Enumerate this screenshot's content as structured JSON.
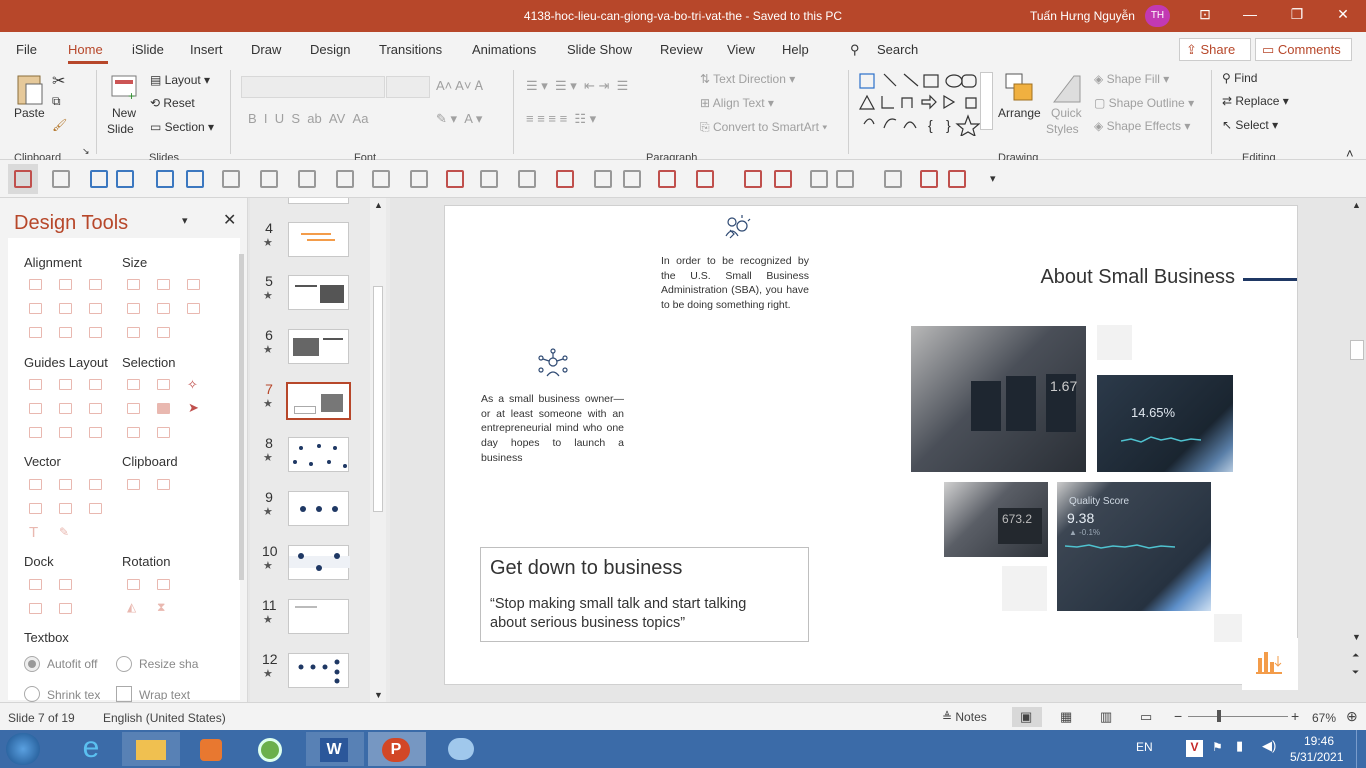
{
  "window": {
    "title": "4138-hoc-lieu-can-giong-va-bo-tri-vat-the  -  Saved to this PC",
    "user": "Tuấn Hưng Nguyễn",
    "initials": "TH"
  },
  "menu": [
    "File",
    "Home",
    "iSlide",
    "Insert",
    "Draw",
    "Design",
    "Transitions",
    "Animations",
    "Slide Show",
    "Review",
    "View",
    "Help"
  ],
  "search_label": "Search",
  "share_label": "Share",
  "comments_label": "Comments",
  "ribbon": {
    "clipboard": {
      "paste": "Paste",
      "group": "Clipboard"
    },
    "slides": {
      "new_slide_1": "New",
      "new_slide_2": "Slide",
      "layout": "Layout",
      "reset": "Reset",
      "section": "Section",
      "group": "Slides"
    },
    "font": {
      "group": "Font"
    },
    "paragraph": {
      "text_direction": "Text Direction",
      "align_text": "Align Text",
      "convert_smartart": "Convert to SmartArt",
      "group": "Paragraph"
    },
    "drawing": {
      "arrange": "Arrange",
      "quick_1": "Quick",
      "quick_2": "Styles",
      "shape_fill": "Shape Fill",
      "shape_outline": "Shape Outline",
      "shape_effects": "Shape Effects",
      "group": "Drawing"
    },
    "editing": {
      "find": "Find",
      "replace": "Replace",
      "select": "Select",
      "group": "Editing"
    }
  },
  "design_tools": {
    "title": "Design Tools",
    "sections": {
      "alignment": "Alignment",
      "size": "Size",
      "guides": "Guides Layout",
      "selection": "Selection",
      "vector": "Vector",
      "clipboard": "Clipboard",
      "dock": "Dock",
      "rotation": "Rotation",
      "textbox": "Textbox"
    },
    "autofit": "Autofit off",
    "resize": "Resize sha",
    "shrink": "Shrink tex",
    "wrap": "Wrap text"
  },
  "thumbnails": [
    {
      "num": "4",
      "star": "★"
    },
    {
      "num": "5",
      "star": "★"
    },
    {
      "num": "6",
      "star": "★"
    },
    {
      "num": "7",
      "star": "★",
      "selected": true
    },
    {
      "num": "8",
      "star": "★"
    },
    {
      "num": "9",
      "star": "★"
    },
    {
      "num": "10",
      "star": "★"
    },
    {
      "num": "11",
      "star": "★"
    },
    {
      "num": "12",
      "star": "★"
    }
  ],
  "slide": {
    "top_text": "In order to be recognized by the U.S. Small Business Administration (SBA), you have to be doing something right.",
    "mid_text": "As a small business owner—or at least someone with an entrepreneurial mind who one day hopes to launch a business",
    "heading": "About Small Business",
    "box_title": "Get down to business",
    "box_quote": "“Stop making small talk and start talking about serious business topics”",
    "img1_value": "1.67",
    "img2_value": "14.65%",
    "img3_value": "673.2",
    "img4_title": "Quality Score",
    "img4_value": "9.38",
    "img4_sub": "▲ -0.1%"
  },
  "status": {
    "slide": "Slide 7 of 19",
    "lang": "English (United States)",
    "notes": "Notes",
    "zoom": "67%"
  },
  "taskbar": {
    "lang": "EN",
    "time": "19:46",
    "date": "5/31/2021"
  },
  "colors": {
    "accent": "#b7472a",
    "navy": "#1f3864"
  }
}
